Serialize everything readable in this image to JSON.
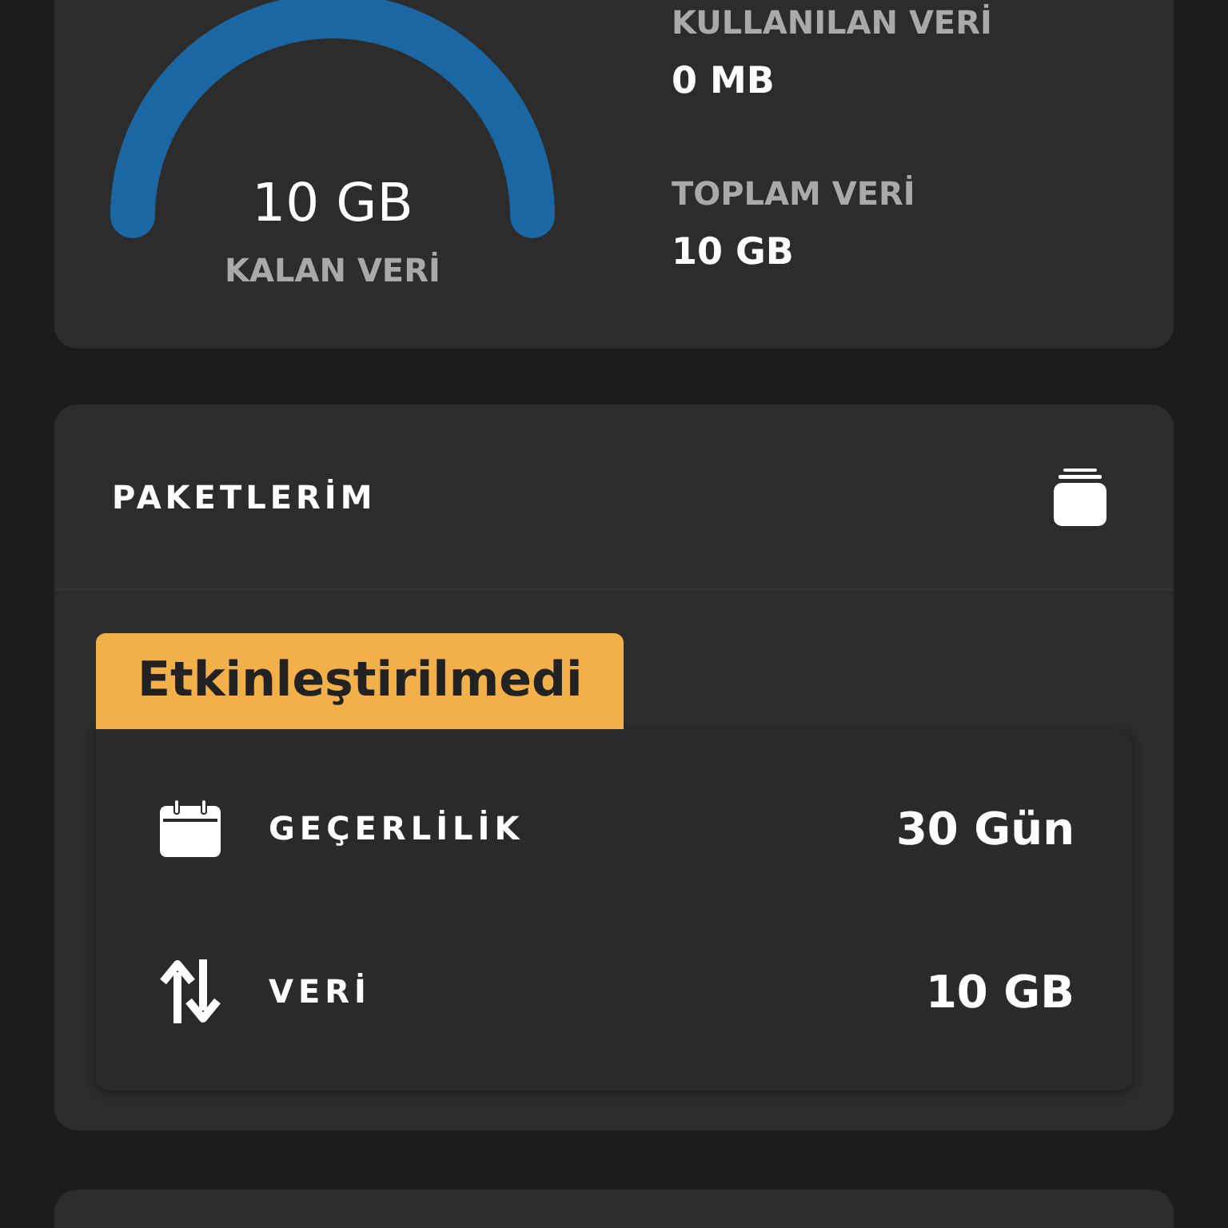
{
  "usage": {
    "gauge": {
      "level": 1,
      "value": "10 GB",
      "label": "KALAN VERİ"
    },
    "stats": [
      {
        "label": "KULLANILAN VERİ",
        "value": "0 MB"
      },
      {
        "label": "TOPLAM VERİ",
        "value": "10 GB"
      }
    ]
  },
  "packages": {
    "title": "PAKETLERİM",
    "status": "Etkinleştirilmedi",
    "rows": [
      {
        "kind": "validity",
        "label": "GEÇERLİLİK",
        "value": "30 Gün"
      },
      {
        "kind": "data",
        "label": "VERİ",
        "value": "10 GB"
      }
    ]
  }
}
